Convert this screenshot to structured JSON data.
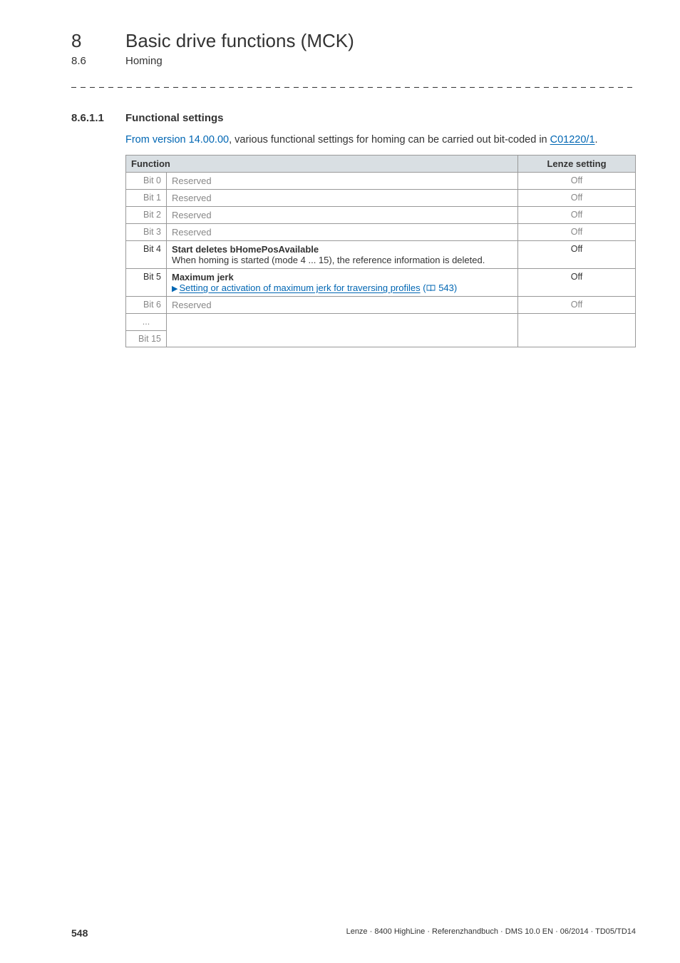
{
  "chapter": {
    "num": "8",
    "title": "Basic drive functions (MCK)"
  },
  "section": {
    "num": "8.6",
    "title": "Homing"
  },
  "subsection": {
    "num": "8.6.1.1",
    "title": "Functional settings"
  },
  "body": {
    "version_prefix": "From version 14.00.00",
    "text1": ", various functional settings for homing can be carried out bit-coded in ",
    "link": "C01220/1",
    "text2": "."
  },
  "table": {
    "head_function": "Function",
    "head_lenze": "Lenze setting",
    "rows": [
      {
        "bit": "Bit 0",
        "desc": "Reserved",
        "setting": "Off",
        "reserved": true
      },
      {
        "bit": "Bit 1",
        "desc": "Reserved",
        "setting": "Off",
        "reserved": true
      },
      {
        "bit": "Bit 2",
        "desc": "Reserved",
        "setting": "Off",
        "reserved": true
      },
      {
        "bit": "Bit 3",
        "desc": "Reserved",
        "setting": "Off",
        "reserved": true
      },
      {
        "bit": "Bit 4",
        "title": "Start deletes bHomePosAvailable",
        "detail": "When homing is started (mode 4 ... 15), the reference information is deleted.",
        "setting": "Off",
        "reserved": false
      },
      {
        "bit": "Bit 5",
        "title": "Maximum jerk",
        "link_text": "Setting or activation of maximum jerk for traversing profiles",
        "page_ref": "543",
        "setting": "Off",
        "reserved": false
      },
      {
        "bit_start": "Bit 6",
        "bit_mid": "...",
        "bit_end": "Bit 15",
        "desc": "Reserved",
        "setting": "Off",
        "reserved": true
      }
    ]
  },
  "footer": {
    "page": "548",
    "text": "Lenze · 8400 HighLine · Referenzhandbuch · DMS 10.0 EN · 06/2014 · TD05/TD14"
  }
}
